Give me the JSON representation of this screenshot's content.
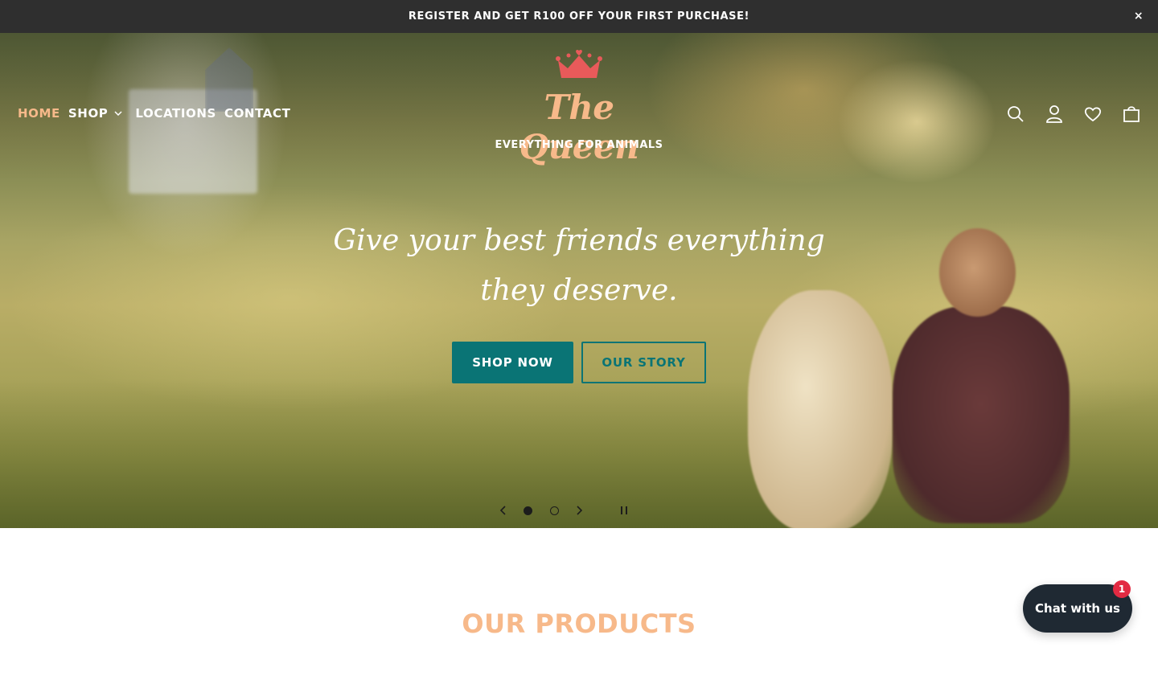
{
  "announcement": {
    "text": "REGISTER AND GET R100 OFF YOUR FIRST PURCHASE!",
    "close_label": "×"
  },
  "nav": {
    "items": [
      {
        "label": "HOME",
        "active": true
      },
      {
        "label": "SHOP",
        "has_dropdown": true
      },
      {
        "label": "LOCATIONS"
      },
      {
        "label": "CONTACT"
      }
    ]
  },
  "logo": {
    "name": "The Queen",
    "tagline": "EVERYTHING FOR ANIMALS",
    "crown_icon": "crown-icon"
  },
  "header_icons": [
    "search-icon",
    "account-icon",
    "wishlist-heart-icon",
    "cart-icon"
  ],
  "hero": {
    "headline": "Give your best friends everything they deserve.",
    "primary_button": "SHOP NOW",
    "secondary_button": "OUR STORY",
    "slides_total": 2,
    "current_slide": 1
  },
  "section": {
    "title": "OUR PRODUCTS"
  },
  "chat": {
    "label": "Chat with us",
    "badge_count": "1"
  },
  "colors": {
    "accent_peach": "#f7b98a",
    "teal": "#0a7475",
    "announcement_bg": "#2f2f2f",
    "chat_bg": "#1f2933",
    "crown": "#e85a5a",
    "badge": "#e22a42"
  }
}
